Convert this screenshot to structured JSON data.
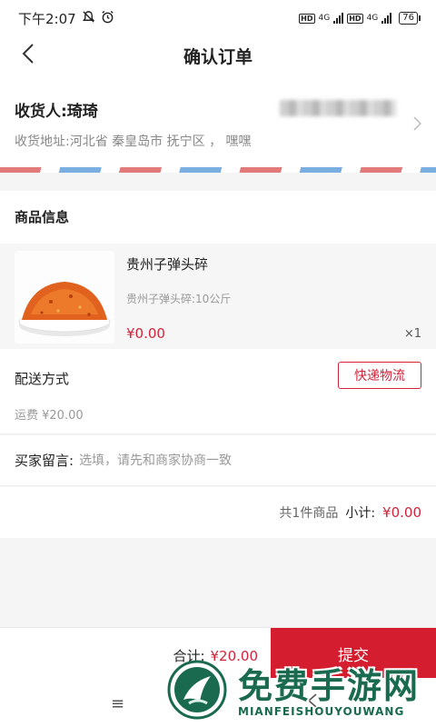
{
  "status_bar": {
    "time": "下午2:07",
    "network_1": "4G",
    "network_2": "4G",
    "hd_1": "HD",
    "hd_2": "HD",
    "battery": "76"
  },
  "nav": {
    "title": "确认订单",
    "back_icon": "chevron-left-icon"
  },
  "address": {
    "recipient": "收货人:琦琦",
    "address": "收货地址:河北省 秦皇岛市 抚宁区 ， 嘿嘿"
  },
  "product_section": {
    "title": "商品信息"
  },
  "product": {
    "name": "贵州子弹头碎",
    "spec": "贵州子弹头碎:10公斤",
    "price": "¥0.00",
    "quantity": "×1"
  },
  "delivery": {
    "label": "配送方式",
    "method": "快递物流",
    "fee": "运费 ¥20.00"
  },
  "message": {
    "label": "买家留言:",
    "placeholder": "选填，请先和商家协商一致"
  },
  "subtotal": {
    "count": "共1件商品",
    "label": "小计:",
    "value": "¥0.00"
  },
  "footer": {
    "total_label": "合计:",
    "total_value": "¥20.00",
    "submit": "提交"
  },
  "system_nav": {
    "menu": "≡"
  },
  "watermark": {
    "title": "免费手游网",
    "subtitle": "MIANFEISHOUYOUWANG"
  },
  "colors": {
    "accent": "#d2233a",
    "submit_bg": "#d41d2e",
    "watermark": "#1a6a50"
  }
}
